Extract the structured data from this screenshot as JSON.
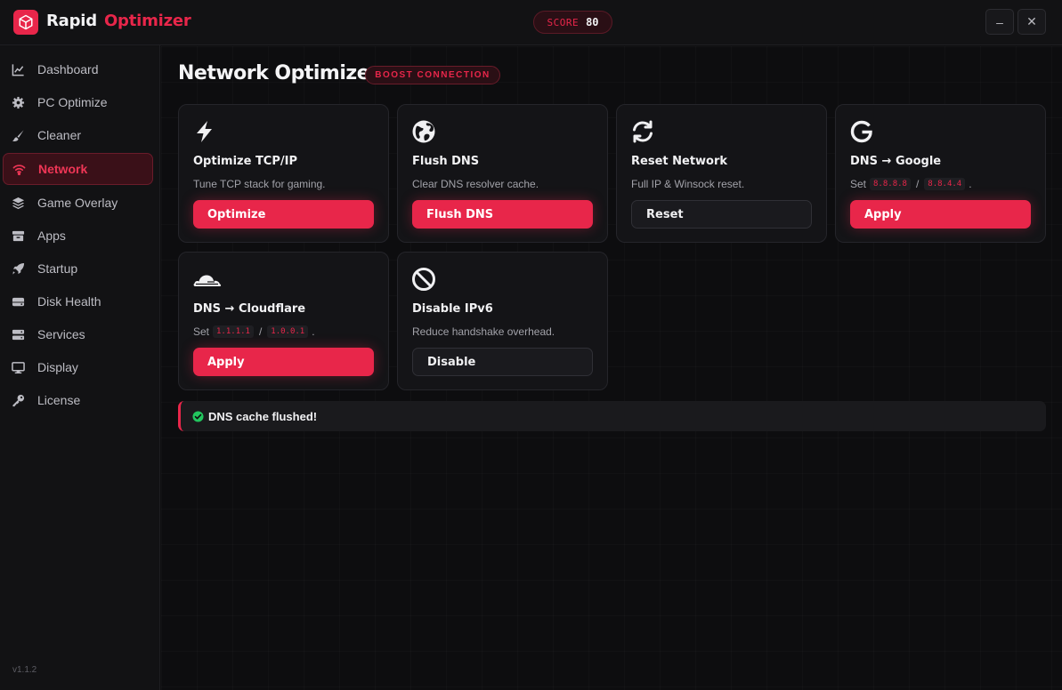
{
  "app": {
    "brand_part1": "Rapid",
    "brand_part2": "Optimizer",
    "score_label": "SCORE",
    "score_value": "80",
    "minimize_label": "–",
    "close_label": "✕",
    "version": "v1.1.2"
  },
  "sidebar": {
    "items": [
      {
        "label": "Dashboard",
        "icon": "chart-line-icon"
      },
      {
        "label": "PC Optimize",
        "icon": "gear-icon"
      },
      {
        "label": "Cleaner",
        "icon": "brush-icon"
      },
      {
        "label": "Network",
        "icon": "wifi-icon",
        "active": true
      },
      {
        "label": "Game Overlay",
        "icon": "layers-icon"
      },
      {
        "label": "Apps",
        "icon": "box-icon"
      },
      {
        "label": "Startup",
        "icon": "rocket-icon"
      },
      {
        "label": "Disk Health",
        "icon": "hard-drive-icon"
      },
      {
        "label": "Services",
        "icon": "server-icon"
      },
      {
        "label": "Display",
        "icon": "monitor-icon"
      },
      {
        "label": "License",
        "icon": "key-icon"
      }
    ]
  },
  "main": {
    "title": "Network Optimizer",
    "badge": "BOOST CONNECTION",
    "cards": [
      {
        "title": "Optimize TCP/IP",
        "desc": "Tune TCP stack for gaming.",
        "button": "Optimize",
        "icon": "bolt-icon"
      },
      {
        "title": "Flush DNS",
        "desc": "Clear DNS resolver cache.",
        "button": "Flush DNS",
        "icon": "globe-icon"
      },
      {
        "title": "Reset Network",
        "desc": "Full IP & Winsock reset.",
        "button": "Reset",
        "icon": "refresh-icon"
      },
      {
        "title": "DNS → Google",
        "desc_prefix": "Set",
        "dns1": "8.8.8.8",
        "sep": "/",
        "dns2": "8.8.4.4",
        "desc_suffix": ".",
        "button": "Apply",
        "icon": "google-icon"
      },
      {
        "title": "DNS → Cloudflare",
        "desc_prefix": "Set",
        "dns1": "1.1.1.1",
        "sep": "/",
        "dns2": "1.0.0.1",
        "desc_suffix": ".",
        "button": "Apply",
        "icon": "cloudflare-icon"
      },
      {
        "title": "Disable IPv6",
        "desc": "Reduce handshake overhead.",
        "button": "Disable",
        "icon": "ban-icon"
      }
    ],
    "toast": "DNS cache flushed!"
  },
  "colors": {
    "accent": "#e8264a",
    "background": "#0e0e10",
    "success": "#22c55e"
  }
}
